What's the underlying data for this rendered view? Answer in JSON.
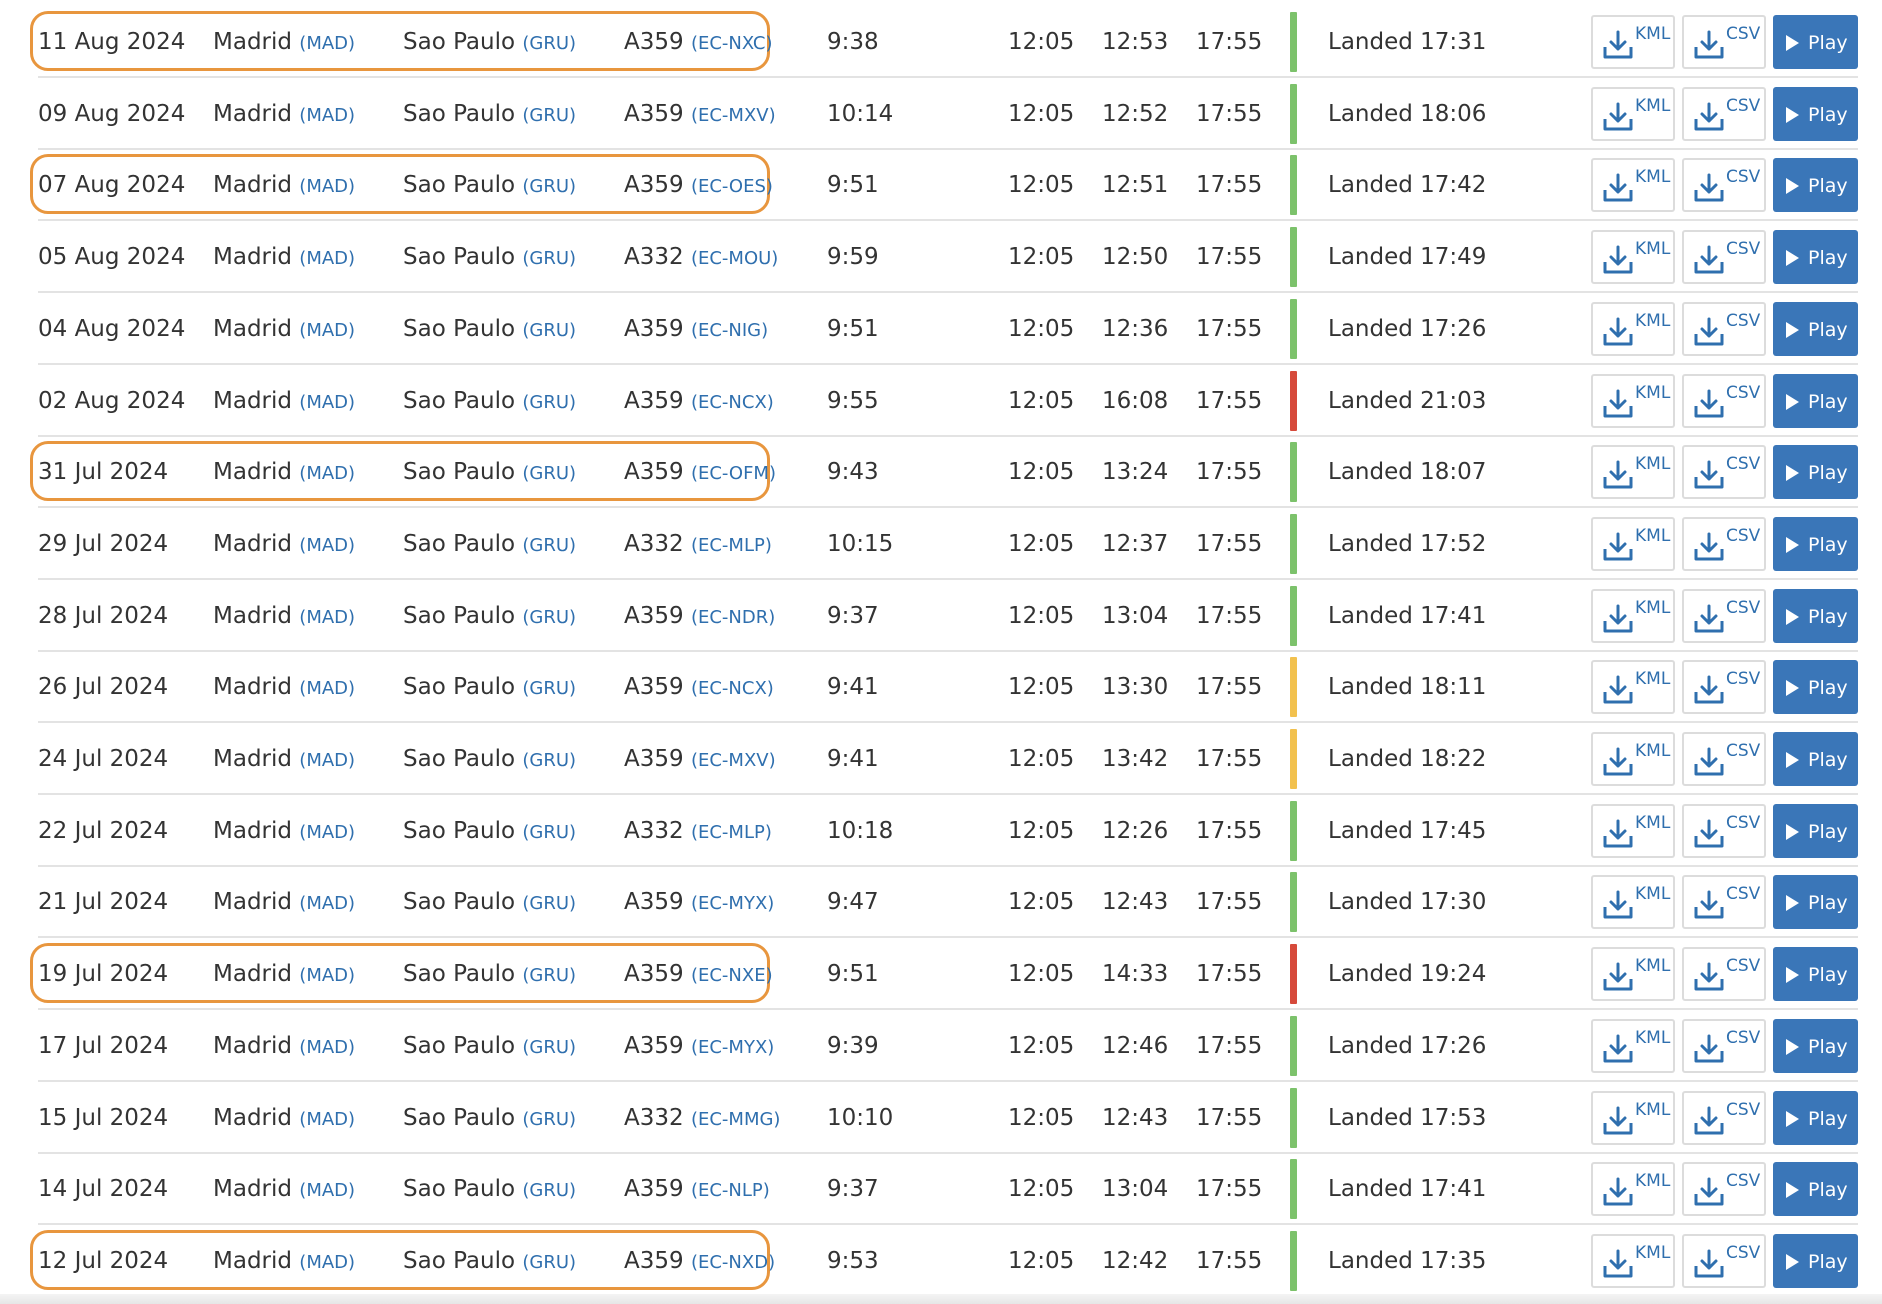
{
  "status_colors": {
    "green": "#7cc26b",
    "red": "#d64a3b",
    "yellow": "#f2c14e"
  },
  "highlight_color": "#e8963e",
  "buttons": {
    "kml": "KML",
    "csv": "CSV",
    "play": "Play"
  },
  "icons": {
    "download": "download-icon",
    "play": "play-icon"
  },
  "flights": [
    {
      "date": "11 Aug 2024",
      "from": "Madrid",
      "from_code": "(MAD)",
      "to": "Sao Paulo",
      "to_code": "(GRU)",
      "aircraft": "A359",
      "reg": "(EC-NXC)",
      "duration": "9:38",
      "sched_dep": "12:05",
      "actual_dep": "12:53",
      "sched_arr": "17:55",
      "status_color": "green",
      "status": "Landed 17:31",
      "highlighted": true
    },
    {
      "date": "09 Aug 2024",
      "from": "Madrid",
      "from_code": "(MAD)",
      "to": "Sao Paulo",
      "to_code": "(GRU)",
      "aircraft": "A359",
      "reg": "(EC-MXV)",
      "duration": "10:14",
      "sched_dep": "12:05",
      "actual_dep": "12:52",
      "sched_arr": "17:55",
      "status_color": "green",
      "status": "Landed 18:06",
      "highlighted": false
    },
    {
      "date": "07 Aug 2024",
      "from": "Madrid",
      "from_code": "(MAD)",
      "to": "Sao Paulo",
      "to_code": "(GRU)",
      "aircraft": "A359",
      "reg": "(EC-OES)",
      "duration": "9:51",
      "sched_dep": "12:05",
      "actual_dep": "12:51",
      "sched_arr": "17:55",
      "status_color": "green",
      "status": "Landed 17:42",
      "highlighted": true
    },
    {
      "date": "05 Aug 2024",
      "from": "Madrid",
      "from_code": "(MAD)",
      "to": "Sao Paulo",
      "to_code": "(GRU)",
      "aircraft": "A332",
      "reg": "(EC-MOU)",
      "duration": "9:59",
      "sched_dep": "12:05",
      "actual_dep": "12:50",
      "sched_arr": "17:55",
      "status_color": "green",
      "status": "Landed 17:49",
      "highlighted": false
    },
    {
      "date": "04 Aug 2024",
      "from": "Madrid",
      "from_code": "(MAD)",
      "to": "Sao Paulo",
      "to_code": "(GRU)",
      "aircraft": "A359",
      "reg": "(EC-NIG)",
      "duration": "9:51",
      "sched_dep": "12:05",
      "actual_dep": "12:36",
      "sched_arr": "17:55",
      "status_color": "green",
      "status": "Landed 17:26",
      "highlighted": false
    },
    {
      "date": "02 Aug 2024",
      "from": "Madrid",
      "from_code": "(MAD)",
      "to": "Sao Paulo",
      "to_code": "(GRU)",
      "aircraft": "A359",
      "reg": "(EC-NCX)",
      "duration": "9:55",
      "sched_dep": "12:05",
      "actual_dep": "16:08",
      "sched_arr": "17:55",
      "status_color": "red",
      "status": "Landed 21:03",
      "highlighted": false
    },
    {
      "date": "31 Jul 2024",
      "from": "Madrid",
      "from_code": "(MAD)",
      "to": "Sao Paulo",
      "to_code": "(GRU)",
      "aircraft": "A359",
      "reg": "(EC-OFM)",
      "duration": "9:43",
      "sched_dep": "12:05",
      "actual_dep": "13:24",
      "sched_arr": "17:55",
      "status_color": "green",
      "status": "Landed 18:07",
      "highlighted": true
    },
    {
      "date": "29 Jul 2024",
      "from": "Madrid",
      "from_code": "(MAD)",
      "to": "Sao Paulo",
      "to_code": "(GRU)",
      "aircraft": "A332",
      "reg": "(EC-MLP)",
      "duration": "10:15",
      "sched_dep": "12:05",
      "actual_dep": "12:37",
      "sched_arr": "17:55",
      "status_color": "green",
      "status": "Landed 17:52",
      "highlighted": false
    },
    {
      "date": "28 Jul 2024",
      "from": "Madrid",
      "from_code": "(MAD)",
      "to": "Sao Paulo",
      "to_code": "(GRU)",
      "aircraft": "A359",
      "reg": "(EC-NDR)",
      "duration": "9:37",
      "sched_dep": "12:05",
      "actual_dep": "13:04",
      "sched_arr": "17:55",
      "status_color": "green",
      "status": "Landed 17:41",
      "highlighted": false
    },
    {
      "date": "26 Jul 2024",
      "from": "Madrid",
      "from_code": "(MAD)",
      "to": "Sao Paulo",
      "to_code": "(GRU)",
      "aircraft": "A359",
      "reg": "(EC-NCX)",
      "duration": "9:41",
      "sched_dep": "12:05",
      "actual_dep": "13:30",
      "sched_arr": "17:55",
      "status_color": "yellow",
      "status": "Landed 18:11",
      "highlighted": false
    },
    {
      "date": "24 Jul 2024",
      "from": "Madrid",
      "from_code": "(MAD)",
      "to": "Sao Paulo",
      "to_code": "(GRU)",
      "aircraft": "A359",
      "reg": "(EC-MXV)",
      "duration": "9:41",
      "sched_dep": "12:05",
      "actual_dep": "13:42",
      "sched_arr": "17:55",
      "status_color": "yellow",
      "status": "Landed 18:22",
      "highlighted": false
    },
    {
      "date": "22 Jul 2024",
      "from": "Madrid",
      "from_code": "(MAD)",
      "to": "Sao Paulo",
      "to_code": "(GRU)",
      "aircraft": "A332",
      "reg": "(EC-MLP)",
      "duration": "10:18",
      "sched_dep": "12:05",
      "actual_dep": "12:26",
      "sched_arr": "17:55",
      "status_color": "green",
      "status": "Landed 17:45",
      "highlighted": false
    },
    {
      "date": "21 Jul 2024",
      "from": "Madrid",
      "from_code": "(MAD)",
      "to": "Sao Paulo",
      "to_code": "(GRU)",
      "aircraft": "A359",
      "reg": "(EC-MYX)",
      "duration": "9:47",
      "sched_dep": "12:05",
      "actual_dep": "12:43",
      "sched_arr": "17:55",
      "status_color": "green",
      "status": "Landed 17:30",
      "highlighted": false
    },
    {
      "date": "19 Jul 2024",
      "from": "Madrid",
      "from_code": "(MAD)",
      "to": "Sao Paulo",
      "to_code": "(GRU)",
      "aircraft": "A359",
      "reg": "(EC-NXE)",
      "duration": "9:51",
      "sched_dep": "12:05",
      "actual_dep": "14:33",
      "sched_arr": "17:55",
      "status_color": "red",
      "status": "Landed 19:24",
      "highlighted": true
    },
    {
      "date": "17 Jul 2024",
      "from": "Madrid",
      "from_code": "(MAD)",
      "to": "Sao Paulo",
      "to_code": "(GRU)",
      "aircraft": "A359",
      "reg": "(EC-MYX)",
      "duration": "9:39",
      "sched_dep": "12:05",
      "actual_dep": "12:46",
      "sched_arr": "17:55",
      "status_color": "green",
      "status": "Landed 17:26",
      "highlighted": false
    },
    {
      "date": "15 Jul 2024",
      "from": "Madrid",
      "from_code": "(MAD)",
      "to": "Sao Paulo",
      "to_code": "(GRU)",
      "aircraft": "A332",
      "reg": "(EC-MMG)",
      "duration": "10:10",
      "sched_dep": "12:05",
      "actual_dep": "12:43",
      "sched_arr": "17:55",
      "status_color": "green",
      "status": "Landed 17:53",
      "highlighted": false
    },
    {
      "date": "14 Jul 2024",
      "from": "Madrid",
      "from_code": "(MAD)",
      "to": "Sao Paulo",
      "to_code": "(GRU)",
      "aircraft": "A359",
      "reg": "(EC-NLP)",
      "duration": "9:37",
      "sched_dep": "12:05",
      "actual_dep": "13:04",
      "sched_arr": "17:55",
      "status_color": "green",
      "status": "Landed 17:41",
      "highlighted": false
    },
    {
      "date": "12 Jul 2024",
      "from": "Madrid",
      "from_code": "(MAD)",
      "to": "Sao Paulo",
      "to_code": "(GRU)",
      "aircraft": "A359",
      "reg": "(EC-NXD)",
      "duration": "9:53",
      "sched_dep": "12:05",
      "actual_dep": "12:42",
      "sched_arr": "17:55",
      "status_color": "green",
      "status": "Landed 17:35",
      "highlighted": true
    }
  ]
}
